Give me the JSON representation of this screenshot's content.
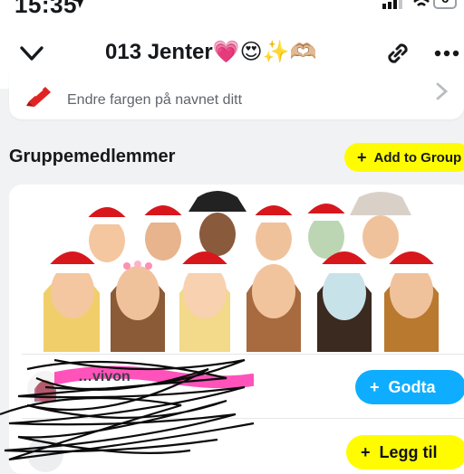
{
  "status_bar": {
    "time": "15:35",
    "battery": "6",
    "icons": [
      "location-arrow-icon",
      "signal-icon",
      "wifi-icon",
      "battery-icon"
    ]
  },
  "header": {
    "title": "013 Jenter💗😍✨🫶🏼",
    "icons": [
      "chevron-down-icon",
      "link-icon",
      "more-icon"
    ]
  },
  "name_color": {
    "subtitle": "Endre fargen på navnet ditt",
    "icons": [
      "crayon-icon",
      "chevron-right-icon"
    ]
  },
  "members_section": {
    "title": "Gruppemedlemmer",
    "add_button": {
      "plus": "+",
      "label": "Add to Group"
    }
  },
  "member_rows": [
    {
      "name": "…vivon",
      "action": {
        "plus": "+",
        "label": "Godta"
      }
    },
    {
      "name": "",
      "action": {
        "plus": "+",
        "label": "Legg til"
      }
    }
  ],
  "colors": {
    "snap_yellow": "#fffc00",
    "accept_blue": "#0fadff",
    "highlight_pink": "#ff3fb4"
  }
}
